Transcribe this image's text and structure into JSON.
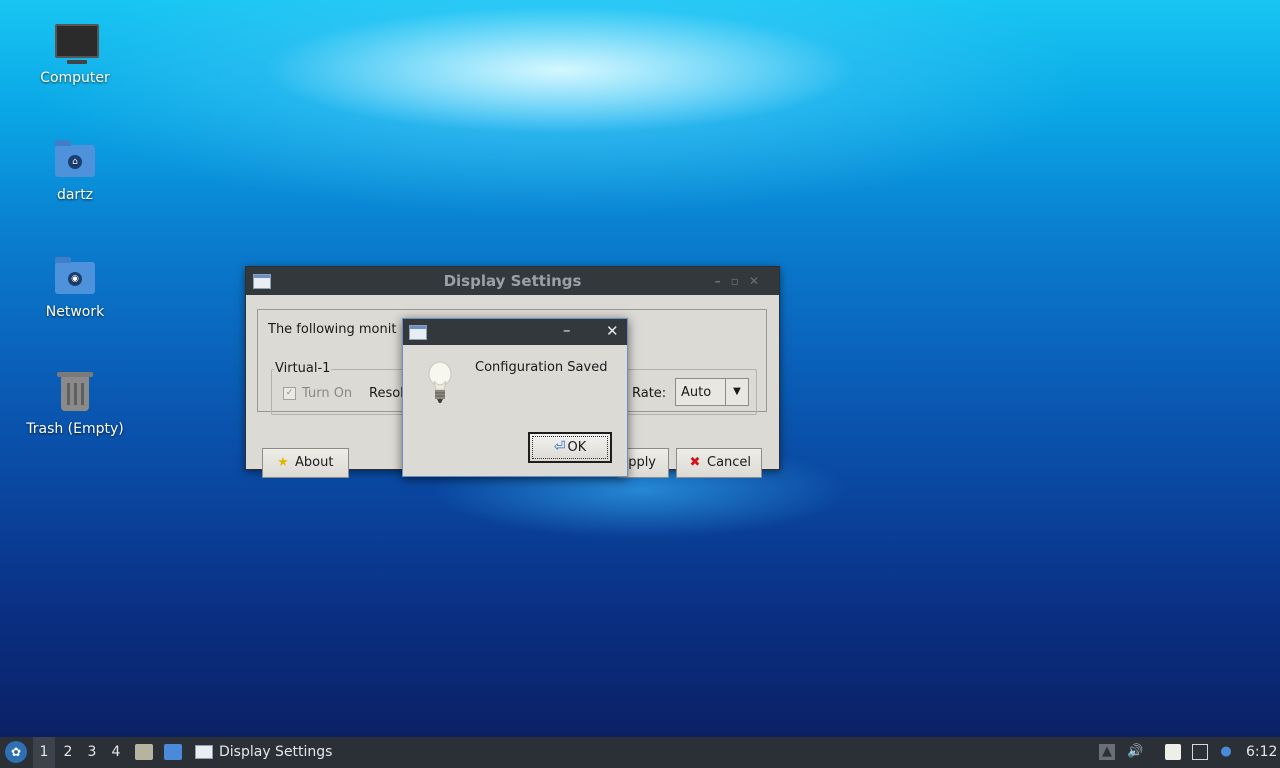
{
  "desktop": {
    "icons": [
      {
        "label": "Computer"
      },
      {
        "label": "dartz"
      },
      {
        "label": "Network"
      },
      {
        "label": "Trash (Empty)"
      }
    ]
  },
  "display_settings": {
    "title": "Display Settings",
    "monitors_text": "The following monit",
    "group_label": "Virtual-1",
    "turn_on_label": "Turn On",
    "turn_on_checked": true,
    "resolution_label": "Resol",
    "rate_label": "Rate:",
    "rate_value": "Auto",
    "about_label": "About",
    "apply_label": "pply",
    "cancel_label": "Cancel"
  },
  "dialog": {
    "message": "Configuration Saved",
    "ok_label": "OK",
    "icon": "lightbulb-icon"
  },
  "taskbar": {
    "workspaces": [
      "1",
      "2",
      "3",
      "4"
    ],
    "active_workspace": "1",
    "task_label": "Display Settings",
    "clock": "6:12"
  }
}
